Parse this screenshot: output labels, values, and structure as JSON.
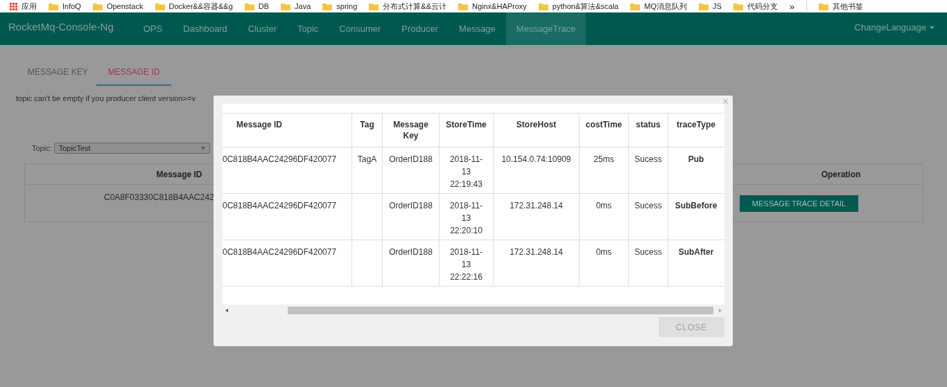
{
  "bookmarks": [
    {
      "kind": "apps",
      "label": "应用"
    },
    {
      "kind": "folder",
      "label": "InfoQ"
    },
    {
      "kind": "folder",
      "label": "Openstack"
    },
    {
      "kind": "folder",
      "label": "Docker&&容器&&g"
    },
    {
      "kind": "folder",
      "label": "DB"
    },
    {
      "kind": "folder",
      "label": "Java"
    },
    {
      "kind": "folder",
      "label": "spring"
    },
    {
      "kind": "folder",
      "label": "分布式计算&&云计"
    },
    {
      "kind": "folder",
      "label": "Nginx&HAProxy"
    },
    {
      "kind": "folder",
      "label": "python&算法&scala"
    },
    {
      "kind": "folder",
      "label": "MQ消息队列"
    },
    {
      "kind": "folder",
      "label": "JS"
    },
    {
      "kind": "folder",
      "label": "代码分支"
    },
    {
      "kind": "overflow",
      "label": "»"
    },
    {
      "kind": "other",
      "label": "其他书签"
    }
  ],
  "navbar": {
    "brand": "RocketMq-Console-Ng",
    "items": [
      {
        "label": "OPS",
        "selected": false
      },
      {
        "label": "Dashboard",
        "selected": false
      },
      {
        "label": "Cluster",
        "selected": false
      },
      {
        "label": "Topic",
        "selected": false
      },
      {
        "label": "Consumer",
        "selected": false
      },
      {
        "label": "Producer",
        "selected": false
      },
      {
        "label": "Message",
        "selected": false
      },
      {
        "label": "MessageTrace",
        "selected": true
      }
    ],
    "language": "ChangeLanguage"
  },
  "tabs": [
    {
      "label": "MESSAGE KEY",
      "selected": false
    },
    {
      "label": "MESSAGE ID",
      "selected": true
    }
  ],
  "notice": "topic can't be empty if you producer client version>=v",
  "topic_select": {
    "label": "Topic:",
    "value": "TopicTest"
  },
  "results_table": {
    "columns": [
      "Message ID",
      "Operation"
    ],
    "rows": [
      {
        "message_id": "C0A8F03330C818B4AAC242",
        "action": "MESSAGE TRACE DETAIL"
      }
    ]
  },
  "dialog": {
    "close_icon": "×",
    "columns": [
      "Message ID",
      "Tag",
      "Message Key",
      "StoreTime",
      "StoreHost",
      "costTime",
      "status",
      "traceType"
    ],
    "rows": [
      [
        "0C818B4AAC24296DF420077",
        "TagA",
        "OrderID188",
        "2018-11-13 22:19:43",
        "10.154.0.74:10909",
        "25ms",
        "Sucess",
        "Pub"
      ],
      [
        "0C818B4AAC24296DF420077",
        "",
        "OrderID188",
        "2018-11-13 22:20:10",
        "172.31.248.14",
        "0ms",
        "Sucess",
        "SubBefore"
      ],
      [
        "0C818B4AAC24296DF420077",
        "",
        "OrderID188",
        "2018-11-13 22:22:16",
        "172.31.248.14",
        "0ms",
        "Sucess",
        "SubAfter"
      ]
    ],
    "close_button": "CLOSE"
  }
}
